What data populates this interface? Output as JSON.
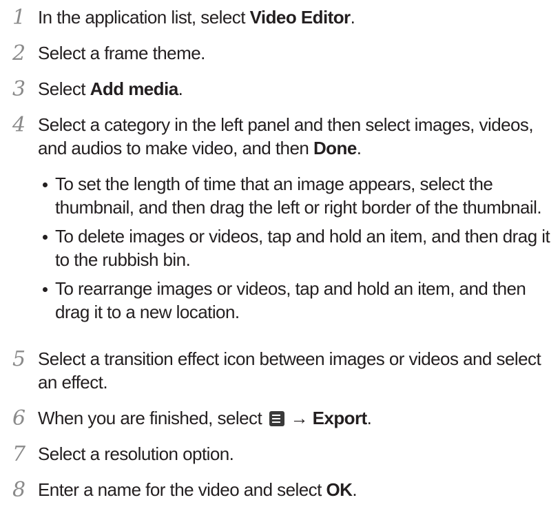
{
  "steps": [
    {
      "number": "1",
      "lead": "In the application list, select ",
      "bold": "Video Editor",
      "tail": "."
    },
    {
      "number": "2",
      "text": "Select a frame theme."
    },
    {
      "number": "3",
      "lead": "Select ",
      "bold": "Add media",
      "tail": "."
    },
    {
      "number": "4",
      "lead": "Select a category in the left panel and then select images, videos, and audios to make video, and then ",
      "bold": "Done",
      "tail": ".",
      "bullets": [
        "To set the length of time that an image appears, select the thumbnail, and then drag the left or right border of the thumbnail.",
        "To delete images or videos, tap and hold an item, and then drag it to the rubbish bin.",
        "To rearrange images or videos, tap and hold an item, and then drag it to a new location."
      ]
    },
    {
      "number": "5",
      "text": "Select a transition effect icon between images or videos and select an effect."
    },
    {
      "number": "6",
      "lead": "When you are finished, select ",
      "icon": "menu-icon",
      "arrow": "→",
      "bold": "Export",
      "tail": "."
    },
    {
      "number": "7",
      "text": "Select a resolution option."
    },
    {
      "number": "8",
      "lead": "Enter a name for the video and select ",
      "bold": "OK",
      "tail": "."
    }
  ]
}
